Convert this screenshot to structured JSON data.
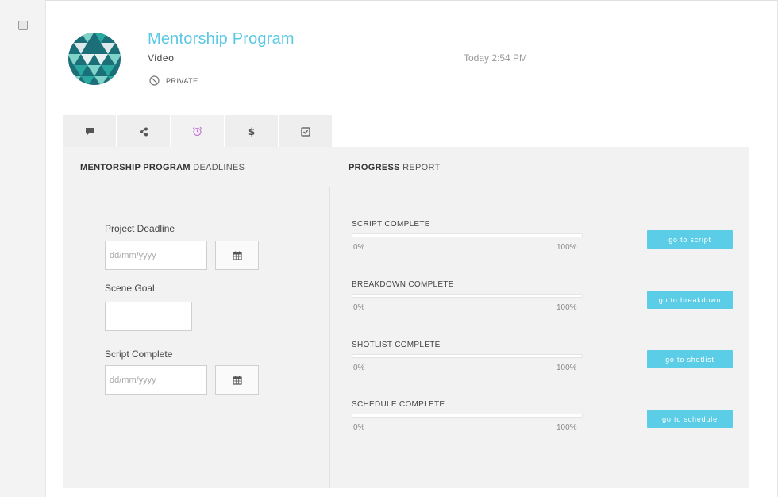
{
  "project": {
    "title": "Mentorship Program",
    "type": "Video",
    "privacy": "PRIVATE",
    "timestamp": "Today 2:54 PM"
  },
  "tabs": [
    {
      "icon": "comment-icon"
    },
    {
      "icon": "share-icon"
    },
    {
      "icon": "alarm-clock-icon",
      "active": true
    },
    {
      "icon": "dollar-icon"
    },
    {
      "icon": "checkbox-icon"
    }
  ],
  "deadlines": {
    "heading_bold": "MENTORSHIP PROGRAM",
    "heading_rest": " DEADLINES",
    "fields": {
      "project_deadline": {
        "label": "Project Deadline",
        "placeholder": "dd/mm/yyyy",
        "value": ""
      },
      "scene_goal": {
        "label": "Scene Goal",
        "value": ""
      },
      "script_complete": {
        "label": "Script Complete",
        "placeholder": "dd/mm/yyyy",
        "value": ""
      }
    }
  },
  "progress": {
    "heading_bold": "PROGRESS",
    "heading_rest": " REPORT",
    "items": [
      {
        "label": "SCRIPT COMPLETE",
        "min": "0%",
        "max": "100%",
        "value": 0,
        "button": "go to script"
      },
      {
        "label": "BREAKDOWN COMPLETE",
        "min": "0%",
        "max": "100%",
        "value": 0,
        "button": "go to breakdown"
      },
      {
        "label": "SHOTLIST COMPLETE",
        "min": "0%",
        "max": "100%",
        "value": 0,
        "button": "go to shotlist"
      },
      {
        "label": "SCHEDULE COMPLETE",
        "min": "0%",
        "max": "100%",
        "value": 0,
        "button": "go to schedule"
      }
    ]
  },
  "colors": {
    "accent": "#5bc8e4",
    "alarm_icon": "#c77dd6",
    "logo_dark": "#1b6f78",
    "logo_mid": "#2aa8a0",
    "logo_light": "#7fd3c8"
  }
}
